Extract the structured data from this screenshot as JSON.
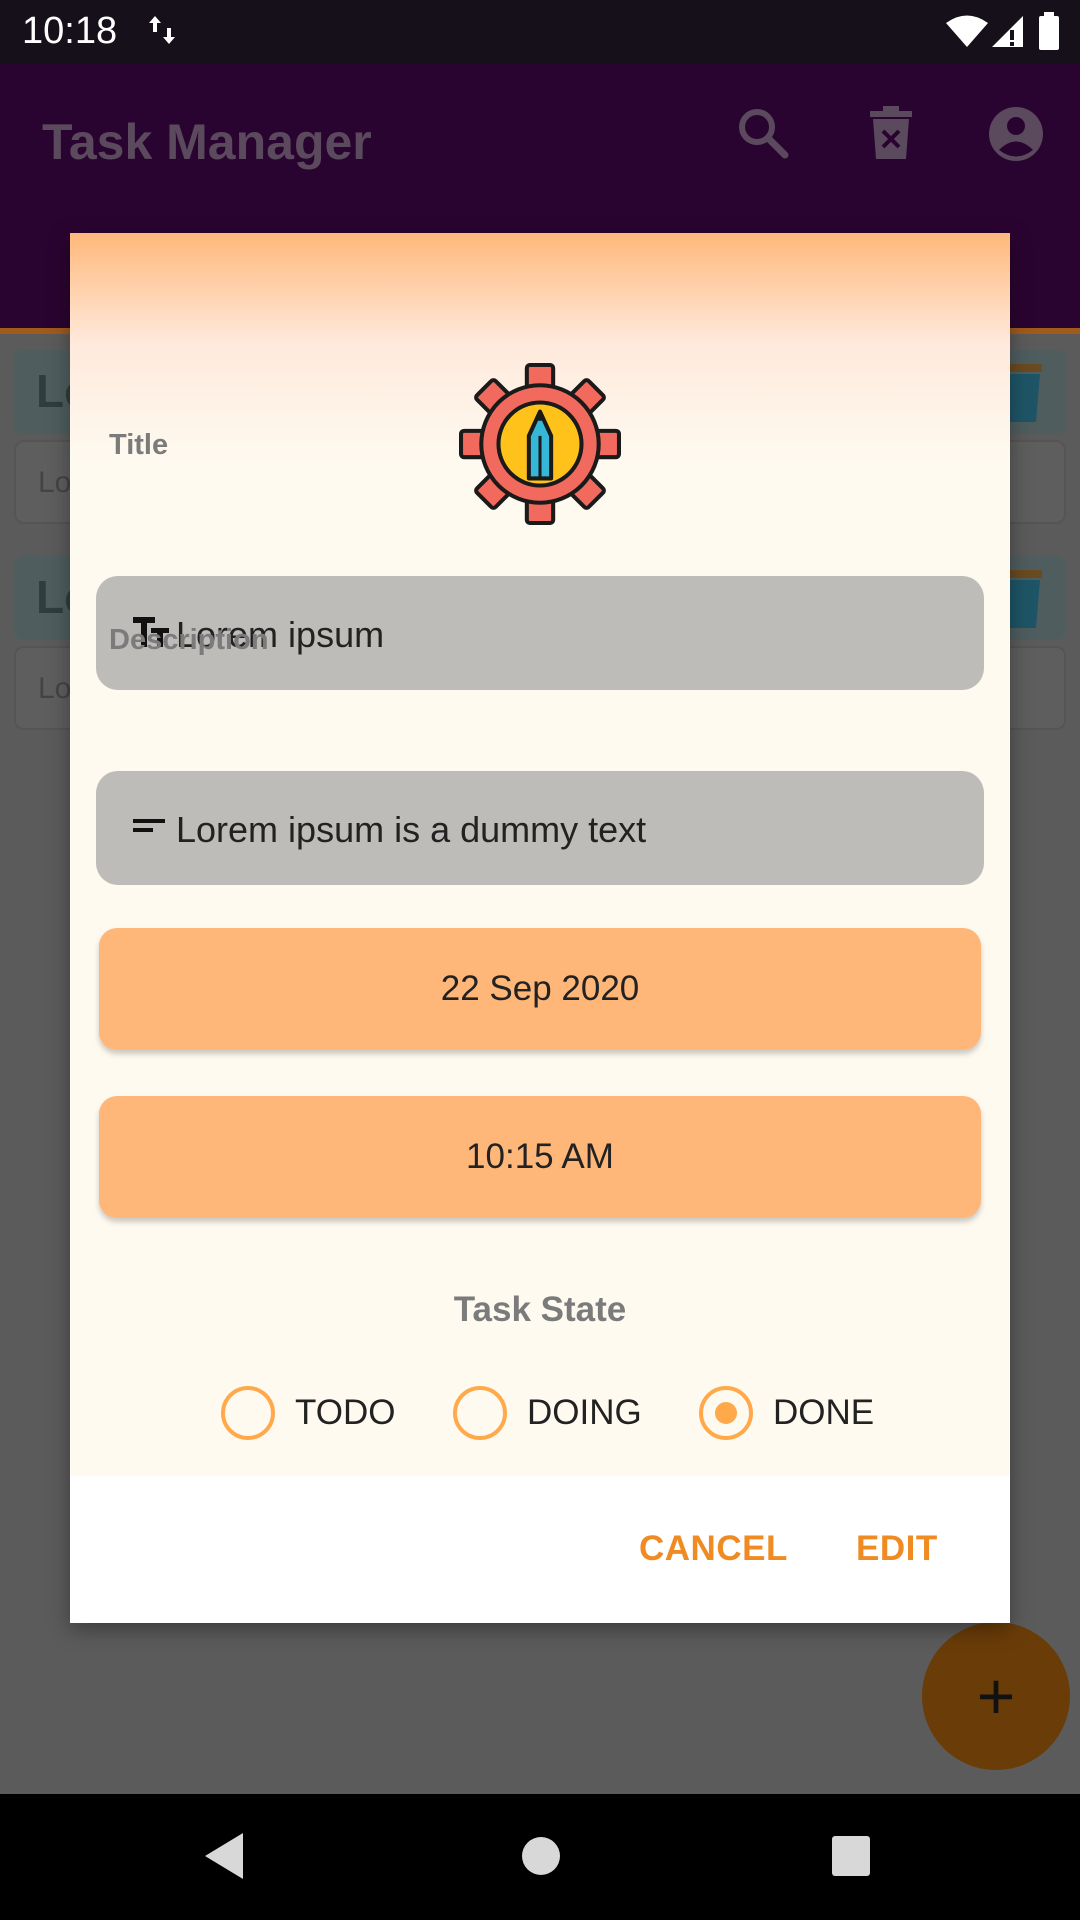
{
  "status_bar": {
    "time": "10:18"
  },
  "app_bar": {
    "title": "Task Manager",
    "icons": [
      "search-icon",
      "delete-all-icon",
      "account-icon"
    ]
  },
  "task_list": [
    {
      "title": "Lo",
      "description": "Lo"
    },
    {
      "title": "Lo",
      "description": "Lo"
    }
  ],
  "fab": {
    "label": "+"
  },
  "dialog": {
    "logo": "gear-pencil-icon",
    "title_label": "Title",
    "title_value": "Lorem ipsum",
    "description_label": "Description",
    "description_value": "Lorem ipsum is a dummy text",
    "date": "22 Sep 2020",
    "time": "10:15 AM",
    "state_title": "Task State",
    "states": [
      {
        "label": "TODO",
        "selected": false
      },
      {
        "label": "DOING",
        "selected": false
      },
      {
        "label": "DONE",
        "selected": true
      }
    ],
    "cancel_label": "CANCEL",
    "edit_label": "EDIT"
  },
  "colors": {
    "accent": "#ffa94a",
    "action": "#ef8b22",
    "button": "#ffb779",
    "field": "#bdbcb8",
    "app_bar": "#2a0430"
  }
}
